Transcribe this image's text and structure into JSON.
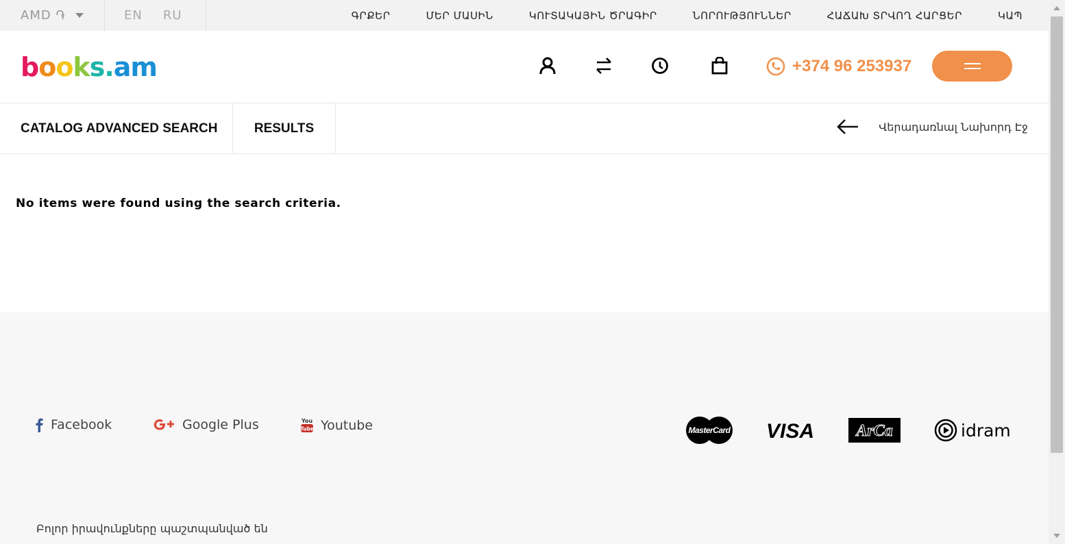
{
  "topbar": {
    "currency": "AMD ֏",
    "languages": [
      "EN",
      "RU"
    ],
    "nav": [
      "ԳՐՔԵՐ",
      "ՄԵՐ ՄԱՍԻՆ",
      "ԿՈՒՏԱԿԱՅԻՆ ԾՐԱԳԻՐ",
      "ՆՈՐՈՒԹՅՈՒՆՆԵՐ",
      "ՀԱՃԱԽ ՏՐՎՈՂ ՀԱՐՑԵՐ",
      "ԿԱՊ"
    ]
  },
  "header": {
    "logo_letters": [
      "b",
      "o",
      "o",
      "k",
      "s",
      ".",
      "a",
      "m"
    ],
    "logo_colors": [
      "#e5195e",
      "#f08a1c",
      "#f5c518",
      "#8dc63f",
      "#1db5a8",
      "#1db5a8",
      "#1a8fd6",
      "#1a8fd6"
    ],
    "icons": [
      "user-icon",
      "compare-icon",
      "history-icon",
      "cart-icon"
    ],
    "phone": "+374 96 253937",
    "accent": "#f0904a"
  },
  "subheader": {
    "tab_catalog": "CATALOG ADVANCED SEARCH",
    "tab_results": "RESULTS",
    "back_label": "Վերադառնալ Նախորդ Էջ"
  },
  "main": {
    "message": "No items were found using the search criteria."
  },
  "footer": {
    "social": [
      {
        "label": "Facebook",
        "icon": "facebook-icon"
      },
      {
        "label": "Google Plus",
        "icon": "google-plus-icon"
      },
      {
        "label": "Youtube",
        "icon": "youtube-icon"
      }
    ],
    "payments": [
      "MasterCard",
      "VISA",
      "ArCa",
      "idram"
    ],
    "copyright": "Բոլոր իրավունքները պաշտպանված են"
  }
}
